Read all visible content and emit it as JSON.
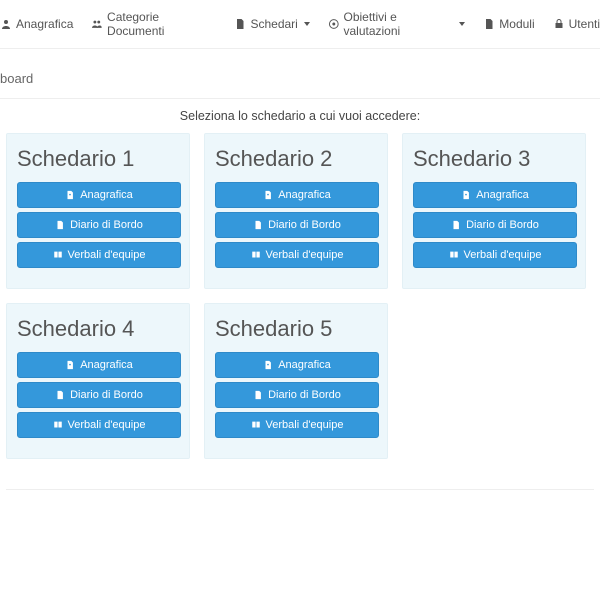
{
  "nav": {
    "anagrafica": "Anagrafica",
    "categorie": "Categorie Documenti",
    "schedari": "Schedari",
    "obiettivi": "Obiettivi e valutazioni",
    "moduli": "Moduli",
    "utenti": "Utenti"
  },
  "breadcrumb": "board",
  "instruction": "Seleziona lo schedario a cui vuoi accedere:",
  "buttons": {
    "anagrafica": "Anagrafica",
    "diario": "Diario di Bordo",
    "verbali": "Verbali d'equipe"
  },
  "cards": [
    {
      "title": "Schedario 1"
    },
    {
      "title": "Schedario 2"
    },
    {
      "title": "Schedario 3"
    },
    {
      "title": "Schedario 4"
    },
    {
      "title": "Schedario 5"
    }
  ]
}
